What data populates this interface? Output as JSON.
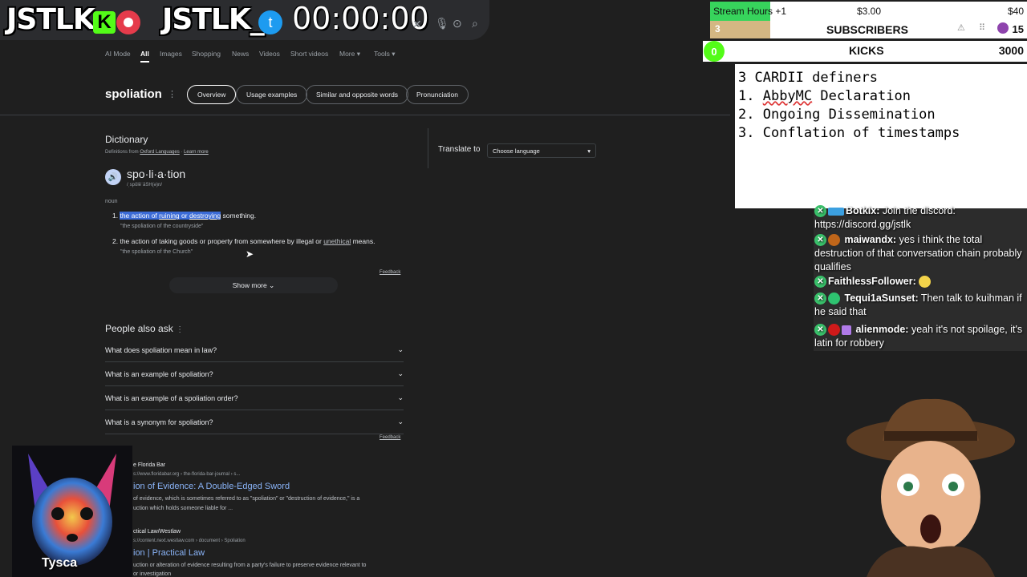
{
  "overlay": {
    "brand_left": "JSTLK",
    "brand_k": "K",
    "brand_right": "JSTLK_",
    "twitter_glyph": "t",
    "timer": "00:00:00"
  },
  "search": {
    "tabs": [
      "AI Mode",
      "All",
      "Images",
      "Shopping",
      "News",
      "Videos",
      "Short videos",
      "More",
      "Tools"
    ],
    "active_tab": "All",
    "icons": [
      "close-icon",
      "mic-icon",
      "lens-icon",
      "search-icon"
    ]
  },
  "term": {
    "title": "spoliation",
    "chips": [
      "Overview",
      "Usage examples",
      "Similar and opposite words",
      "Pronunciation"
    ]
  },
  "dictionary": {
    "heading": "Dictionary",
    "source_prefix": "Definitions from",
    "source_name": "Oxford Languages",
    "learn_more": "Learn more",
    "word": "spo·li·a·tion",
    "phonetic": "/ˌspōlēˈāSH(ə)n/",
    "pos": "noun",
    "definitions": [
      {
        "num": "1.",
        "parts": [
          "the action of ",
          "ruining",
          " or ",
          "destroying",
          " something."
        ],
        "example": "\"the spoliation of the countryside\""
      },
      {
        "num": "2.",
        "parts": [
          "the action of taking goods or property from somewhere by illegal or ",
          "unethical",
          " means."
        ],
        "example": "\"the spoliation of the Church\""
      }
    ],
    "feedback": "Feedback",
    "show_more": "Show more"
  },
  "translate": {
    "label": "Translate to",
    "select_value": "Choose language"
  },
  "paa": {
    "heading": "People also ask",
    "questions": [
      "What does spoliation mean in law?",
      "What is an example of spoliation?",
      "What is an example of a spoliation order?",
      "What is a synonym for spoliation?"
    ],
    "feedback": "Feedback"
  },
  "results": [
    {
      "source": "e Florida Bar",
      "url": "s://www.floridabar.org › the-florida-bar-journal › s...",
      "title": "ion of Evidence: A Double-Edged Sword",
      "snippet_1": "of evidence, which is sometimes referred to as \"spoliation\" or \"destruction of evidence,\" is a",
      "snippet_2": "uction which holds someone liable for ..."
    },
    {
      "source": "ctical Law/Westlaw",
      "url": "s://content.next.westlaw.com › document › Spoliation",
      "title": "ion | Practical Law",
      "snippet_1": "uction or alteration of evidence resulting from a party's failure to preserve evidence relevant to",
      "snippet_2": "or investigation"
    }
  ],
  "stats": {
    "stream_hours": "Stream Hours +1",
    "amount": "$3.00",
    "goal": "$40",
    "subs_count": "3",
    "subscribers_label": "SUBSCRIBERS",
    "subs_goal": "15",
    "kicks_count": "0",
    "kicks_label": "KICKS",
    "kicks_goal": "3000"
  },
  "notes": {
    "line1": "3 CARDII definers",
    "line2_num": "1. ",
    "line2_text": "AbbyMC",
    "line2_rest": " Declaration",
    "line3": "2. Ongoing Dissemination",
    "line4": "3. Conflation of timestamps"
  },
  "chat": [
    {
      "user": "Botkix:",
      "text": " Join the discord: https://discord.gg/jstlk"
    },
    {
      "user": "maiwandx:",
      "text": " yes i think the total destruction of that conversation chain probably qualifies"
    },
    {
      "user": "FaithlessFollower:",
      "text": ""
    },
    {
      "user": "Tequi1aSunset:",
      "text": " Then talk to kuihman if he said that"
    },
    {
      "user": "alienmode:",
      "text": " yeah it's not spoilage, it's latin for robbery"
    }
  ],
  "webcam": {
    "name": "Tysca"
  }
}
